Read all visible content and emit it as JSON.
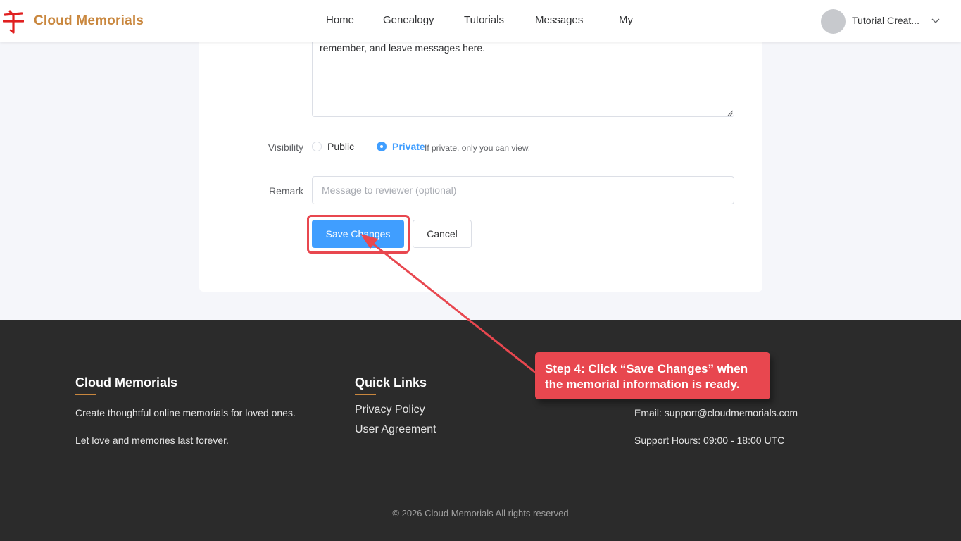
{
  "header": {
    "brand": "Cloud Memorials",
    "nav": [
      "Home",
      "Genealogy",
      "Tutorials",
      "Messages",
      "My"
    ],
    "username": "Tutorial Creat..."
  },
  "form": {
    "textarea_text": "remember, and leave messages here.",
    "visibility": {
      "label": "Visibility",
      "options": [
        "Public",
        "Private"
      ],
      "selected": "Private",
      "hint": "If private, only you can view."
    },
    "remark": {
      "label": "Remark",
      "placeholder": "Message to reviewer (optional)",
      "value": ""
    },
    "save_label": "Save Changes",
    "cancel_label": "Cancel"
  },
  "annotation": {
    "callout_text": "Step 4: Click “Save Changes” when the memorial information is ready."
  },
  "footer": {
    "col1": {
      "title": "Cloud Memorials",
      "lines": [
        "Create thoughtful online memorials for loved ones.",
        "Let love and memories last forever."
      ]
    },
    "col2": {
      "title": "Quick Links",
      "links": [
        "Privacy Policy",
        "User Agreement"
      ]
    },
    "col3": {
      "email": "Email: support@cloudmemorials.com",
      "hours": "Support Hours: 09:00 - 18:00 UTC"
    },
    "copyright": "© 2026 Cloud Memorials All rights reserved"
  },
  "colors": {
    "brand": "#c9873e",
    "primary": "#409eff",
    "annotation": "#e8474f",
    "footer_bg": "#2b2b2b"
  }
}
